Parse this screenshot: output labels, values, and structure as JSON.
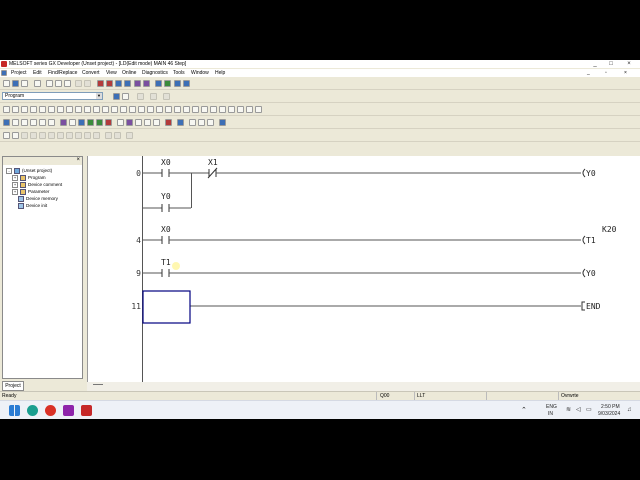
{
  "window": {
    "title": "MELSOFT series GX Developer (Unset project) - [LD(Edit mode)   MAIN   46 Step]",
    "minimize": "_",
    "maximize": "□",
    "close": "×"
  },
  "menu": [
    "Project",
    "Edit",
    "Find/Replace",
    "Convert",
    "View",
    "Online",
    "Diagnostics",
    "Tools",
    "Window",
    "Help"
  ],
  "toolbar": {
    "program_select": "Program"
  },
  "project_panel": {
    "close": "×",
    "tab_label": "Project",
    "tree": [
      {
        "label": "(Unset project)",
        "expander": "-"
      },
      {
        "label": "Program",
        "expander": "+"
      },
      {
        "label": "Device comment",
        "expander": "+"
      },
      {
        "label": "Parameter",
        "expander": "+"
      },
      {
        "label": "Device memory",
        "expander": ""
      },
      {
        "label": "Device init",
        "expander": ""
      }
    ]
  },
  "ladder": {
    "rungs": [
      {
        "step": "0",
        "contacts": [
          "X0",
          "X1"
        ],
        "branch_contact": "Y0",
        "coil": "Y0"
      },
      {
        "step": "4",
        "contacts": [
          "X0"
        ],
        "coil": "T1",
        "coil_param": "K20"
      },
      {
        "step": "9",
        "contacts": [
          "T1"
        ],
        "coil": "Y0"
      },
      {
        "step": "11",
        "instruction": "END"
      }
    ]
  },
  "status": {
    "ready": "Ready",
    "plc": "Q00",
    "cpu": "LLT",
    "mode": "Ovrwrte"
  },
  "tray": {
    "lang1": "ENG",
    "lang2": "IN",
    "time": "2:50 PM",
    "date": "9/03/2024"
  },
  "colors": {
    "accent": "#3d6fb6",
    "ladder_line": "#555555",
    "cursor": "#000080"
  }
}
